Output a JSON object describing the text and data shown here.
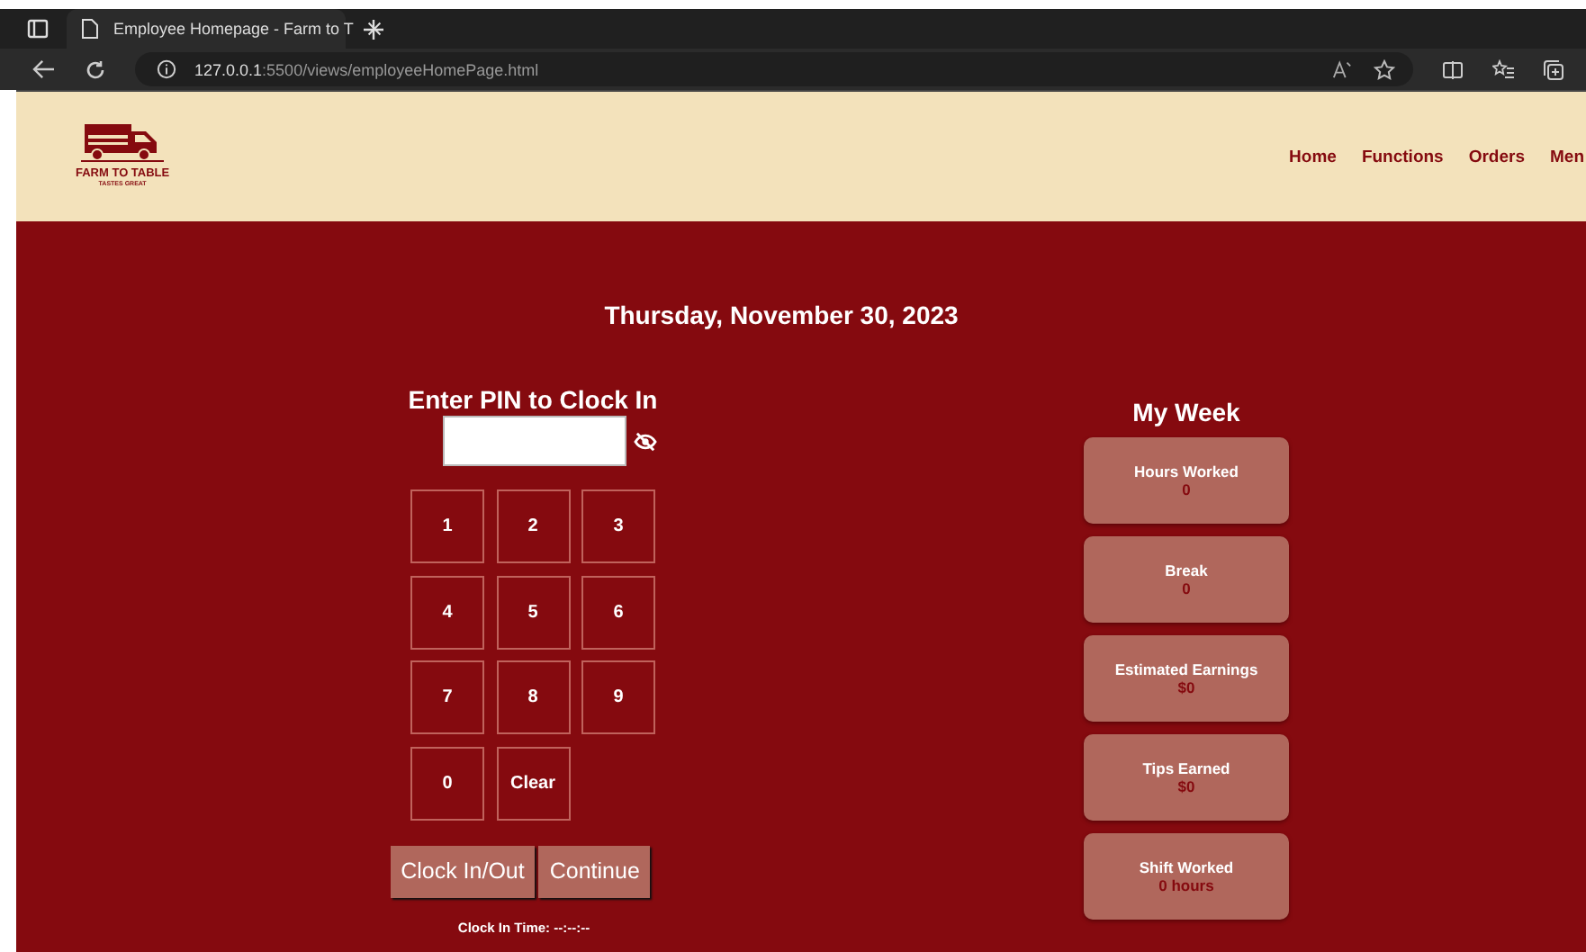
{
  "browser": {
    "tab_title": "Employee Homepage - Farm to T",
    "url_host": "127.0.0.1",
    "url_path": ":5500/views/employeeHomePage.html"
  },
  "header": {
    "logo_title": "FARM TO TABLE",
    "logo_tagline": "TASTES GREAT",
    "nav": [
      {
        "label": "Home"
      },
      {
        "label": "Functions"
      },
      {
        "label": "Orders"
      },
      {
        "label": "Men"
      }
    ]
  },
  "date": "Thursday, November 30, 2023",
  "clock_in": {
    "heading": "Enter PIN to Clock In",
    "pin_masked": true,
    "keys": [
      {
        "label": "1"
      },
      {
        "label": "2"
      },
      {
        "label": "3"
      },
      {
        "label": "4"
      },
      {
        "label": "5"
      },
      {
        "label": "6"
      },
      {
        "label": "7"
      },
      {
        "label": "8"
      },
      {
        "label": "9"
      },
      {
        "label": "0"
      },
      {
        "label": "Clear"
      }
    ],
    "buttons": [
      {
        "label": "Clock In/Out"
      },
      {
        "label": "Continue"
      }
    ],
    "clock_in_time": "Clock In Time: --:--:--"
  },
  "my_week": {
    "heading": "My Week",
    "cards": [
      {
        "label": "Hours Worked",
        "value": "0"
      },
      {
        "label": "Break",
        "value": "0"
      },
      {
        "label": "Estimated Earnings",
        "value": "$0"
      },
      {
        "label": "Tips Earned",
        "value": "$0"
      },
      {
        "label": "Shift Worked",
        "value": "0 hours"
      }
    ]
  }
}
